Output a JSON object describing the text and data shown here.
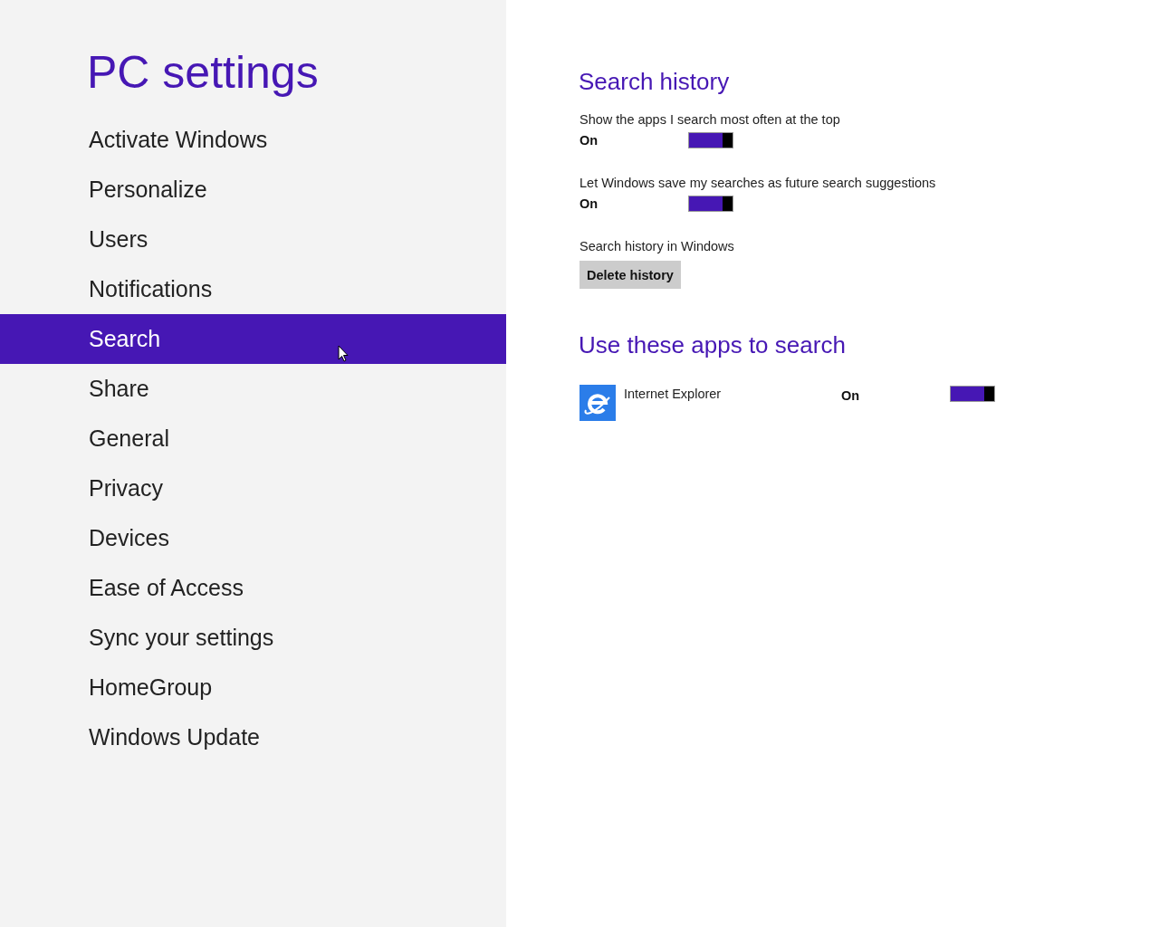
{
  "sidebar": {
    "title": "PC settings",
    "items": [
      {
        "label": "Activate Windows",
        "selected": false
      },
      {
        "label": "Personalize",
        "selected": false
      },
      {
        "label": "Users",
        "selected": false
      },
      {
        "label": "Notifications",
        "selected": false
      },
      {
        "label": "Search",
        "selected": true
      },
      {
        "label": "Share",
        "selected": false
      },
      {
        "label": "General",
        "selected": false
      },
      {
        "label": "Privacy",
        "selected": false
      },
      {
        "label": "Devices",
        "selected": false
      },
      {
        "label": "Ease of Access",
        "selected": false
      },
      {
        "label": "Sync your settings",
        "selected": false
      },
      {
        "label": "HomeGroup",
        "selected": false
      },
      {
        "label": "Windows Update",
        "selected": false
      }
    ]
  },
  "search_history": {
    "heading": "Search history",
    "settings": [
      {
        "label": "Show the apps I search most often at the top",
        "state": "On",
        "on": true
      },
      {
        "label": "Let Windows save my searches as future search suggestions",
        "state": "On",
        "on": true
      }
    ],
    "delete_label": "Search history in Windows",
    "delete_button": "Delete history"
  },
  "apps": {
    "heading": "Use these apps to search",
    "items": [
      {
        "name": "Internet Explorer",
        "state": "On",
        "on": true
      }
    ]
  }
}
